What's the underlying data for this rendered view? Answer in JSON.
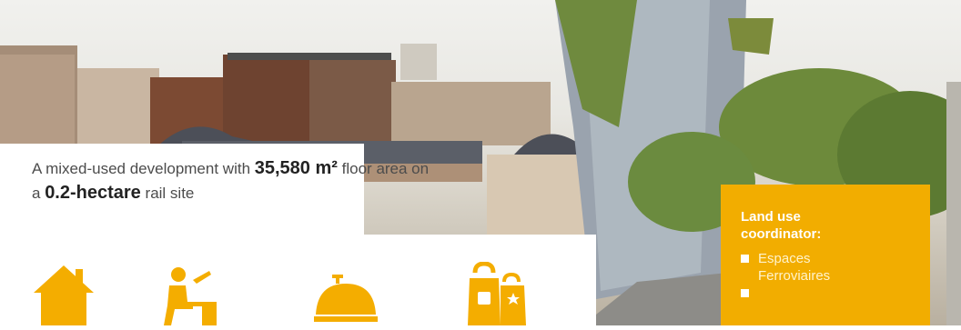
{
  "headline": {
    "prefix": "A mixed-used development with ",
    "area_value": "35,580 m²",
    "middle": " floor area on a ",
    "site_value": "0.2-hectare",
    "suffix": " rail site"
  },
  "icons": [
    "home-icon",
    "office-desk-icon",
    "service-bell-icon",
    "shopping-bags-icon"
  ],
  "coordinator": {
    "title": "Land use coordinator:",
    "items": [
      "Espaces Ferroviaires"
    ]
  },
  "colors": {
    "accent": "#f2ad00",
    "text": "#4c4c4c"
  }
}
